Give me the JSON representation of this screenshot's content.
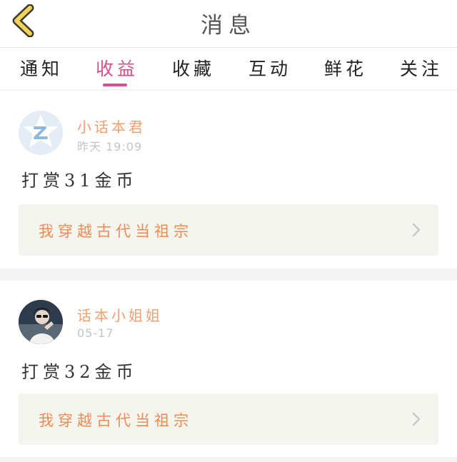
{
  "header": {
    "title": "消息",
    "back_icon": "chevron-left-icon",
    "back_color": "#f2d25a"
  },
  "tabs": [
    {
      "label": "通知"
    },
    {
      "label": "收益",
      "active": true
    },
    {
      "label": "收藏"
    },
    {
      "label": "互动"
    },
    {
      "label": "鲜花"
    },
    {
      "label": "关注"
    }
  ],
  "accent_color": "#d44f8e",
  "messages": [
    {
      "avatar_icon": "default-avatar-icon",
      "name": "小话本君",
      "time": "昨天 19:09",
      "text": "打赏31金币",
      "book_title": "我穿越古代当祖宗"
    },
    {
      "avatar_icon": "user-photo-avatar",
      "name": "话本小姐姐",
      "time": "05-17",
      "text": "打赏32金币",
      "book_title": "我穿越古代当祖宗"
    }
  ]
}
